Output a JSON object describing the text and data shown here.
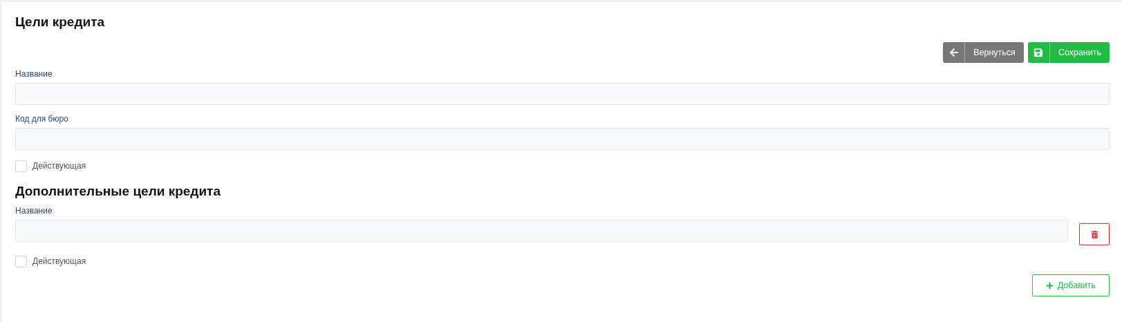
{
  "title": "Цели кредита",
  "actions": [
    {
      "kind": "back",
      "label": "Вернуться"
    },
    {
      "kind": "save",
      "label": "Сохранить"
    }
  ],
  "fields": [
    {
      "label": "Название"
    },
    {
      "label": "Код для бюро"
    }
  ],
  "active": {
    "label": "Действующая",
    "checked": false
  },
  "extra": {
    "title": "Дополнительные цели кредита",
    "items": [
      {
        "label": "Название",
        "active": {
          "label": "Действующая",
          "checked": false
        }
      }
    ],
    "add_label": "Добавить"
  }
}
